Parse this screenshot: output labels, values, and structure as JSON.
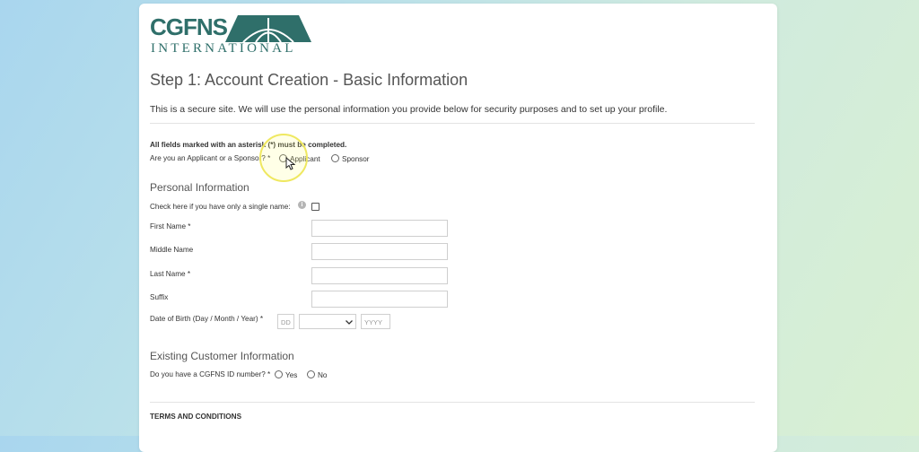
{
  "logo": {
    "name": "CGFNS",
    "sub": "INTERNATIONAL"
  },
  "page": {
    "title": "Step 1: Account Creation - Basic Information",
    "intro": "This is a secure site. We will use the personal information you provide below for security purposes and to set up your profile."
  },
  "required_note": "All fields marked with an asterisk (*) must be completed.",
  "role": {
    "question": "Are you an Applicant or a Sponsor? *",
    "options": [
      "Applicant",
      "Sponsor"
    ]
  },
  "personal": {
    "heading": "Personal Information",
    "single_name_label": "Check here if you have only a single name:",
    "first_name": "First Name *",
    "middle_name": "Middle Name",
    "last_name": "Last Name *",
    "suffix": "Suffix",
    "dob_label": "Date of Birth (Day / Month / Year) *",
    "dob_day_placeholder": "DD",
    "dob_year_placeholder": "YYYY"
  },
  "existing": {
    "heading": "Existing Customer Information",
    "question": "Do you have a CGFNS ID number? *",
    "options": [
      "Yes",
      "No"
    ]
  },
  "terms_heading": "TERMS AND CONDITIONS"
}
